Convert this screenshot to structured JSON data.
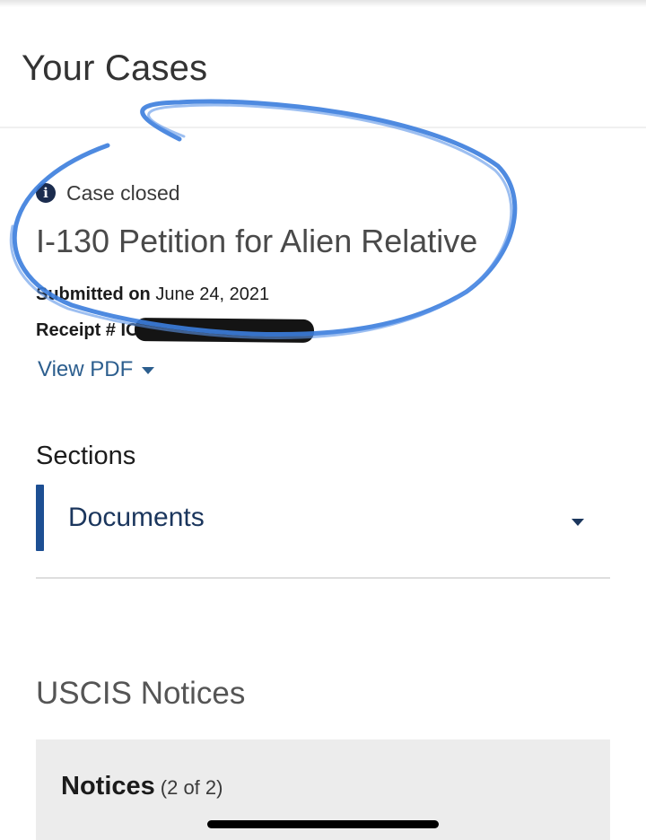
{
  "page": {
    "title": "Your Cases"
  },
  "case": {
    "status_icon": "info-icon",
    "status": "Case closed",
    "name": "I-130 Petition for Alien Relative",
    "submitted_label": "Submitted on",
    "submitted_date": "June 24, 2021",
    "receipt_label": "Receipt # IO",
    "view_pdf_label": "View PDF"
  },
  "sections": {
    "heading": "Sections",
    "items": [
      {
        "label": "Documents"
      }
    ]
  },
  "notices": {
    "heading": "USCIS Notices",
    "label": "Notices",
    "count": "(2 of 2)"
  },
  "colors": {
    "accent": "#1d4f93",
    "link": "#2c5e8e",
    "annotation": "#3b7ddd"
  }
}
